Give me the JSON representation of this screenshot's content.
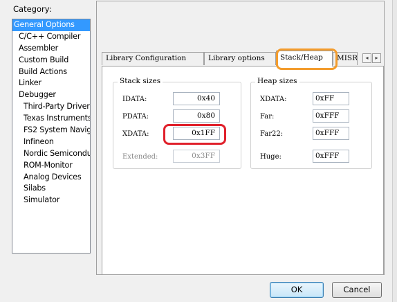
{
  "category": {
    "label": "Category:",
    "items": [
      {
        "label": "General Options",
        "level": 0,
        "selected": true
      },
      {
        "label": "C/C++ Compiler",
        "level": 0
      },
      {
        "label": "Assembler",
        "level": 0
      },
      {
        "label": "Custom Build",
        "level": 0
      },
      {
        "label": "Build Actions",
        "level": 0
      },
      {
        "label": "Linker",
        "level": 0
      },
      {
        "label": "Debugger",
        "level": 0
      },
      {
        "label": "Third-Party Driver",
        "level": 1
      },
      {
        "label": "Texas Instruments",
        "level": 1
      },
      {
        "label": "FS2 System Navig",
        "level": 1
      },
      {
        "label": "Infineon",
        "level": 1
      },
      {
        "label": "Nordic Semiconduc",
        "level": 1
      },
      {
        "label": "ROM-Monitor",
        "level": 1
      },
      {
        "label": "Analog Devices",
        "level": 1
      },
      {
        "label": "Silabs",
        "level": 1
      },
      {
        "label": "Simulator",
        "level": 1
      }
    ]
  },
  "tabs": {
    "items": [
      "Library Configuration",
      "Library options",
      "Stack/Heap",
      "MISRA"
    ],
    "active": "Stack/Heap",
    "scroll_left": "◂",
    "scroll_right": "▸"
  },
  "stack": {
    "title": "Stack sizes",
    "idata_label": "IDATA:",
    "idata_value": "0x40",
    "pdata_label": "PDATA:",
    "pdata_value": "0x80",
    "xdata_label": "XDATA:",
    "xdata_value": "0x1FF",
    "extended_label": "Extended:",
    "extended_value": "0x3FF"
  },
  "heap": {
    "title": "Heap sizes",
    "xdata_label": "XDATA:",
    "xdata_value": "0xFF",
    "far_label": "Far:",
    "far_value": "0xFFF",
    "far22_label": "Far22:",
    "far22_value": "0xFFF",
    "huge_label": "Huge:",
    "huge_value": "0xFFF"
  },
  "buttons": {
    "ok": "OK",
    "cancel": "Cancel"
  },
  "annotations": {
    "orange": "#f39c2d",
    "red": "#e0202b",
    "selection": "#3399ff"
  }
}
